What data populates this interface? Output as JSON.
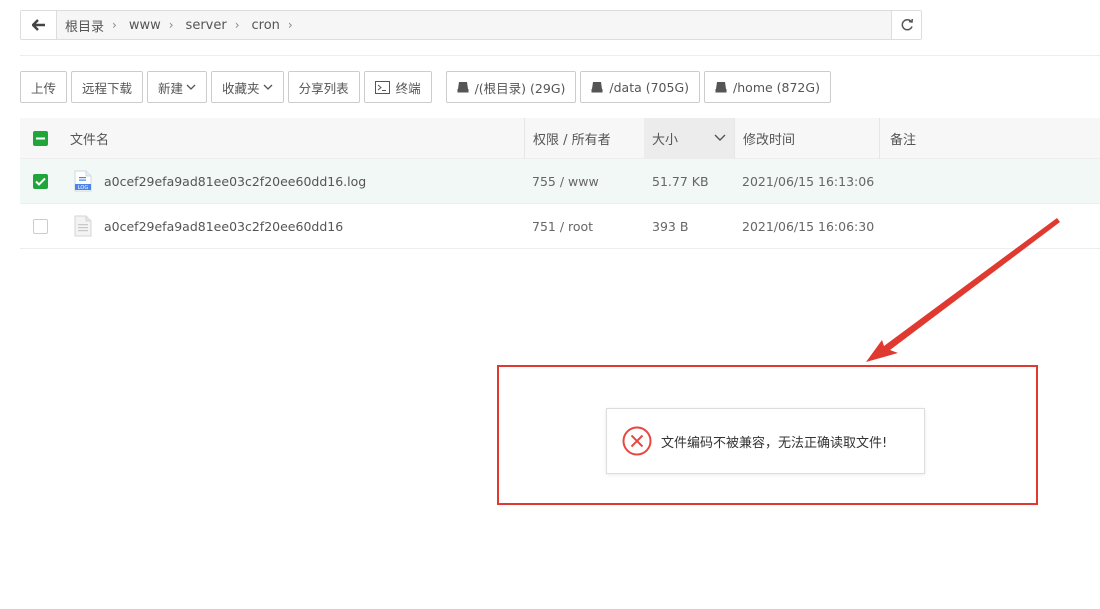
{
  "breadcrumb": {
    "items": [
      "根目录",
      "www",
      "server",
      "cron"
    ]
  },
  "toolbar": {
    "upload": "上传",
    "remote_download": "远程下载",
    "new": "新建",
    "favorites": "收藏夹",
    "share_list": "分享列表",
    "terminal": "终端",
    "disks": [
      {
        "label": "/(根目录) (29G)"
      },
      {
        "label": "/data (705G)"
      },
      {
        "label": "/home (872G)"
      }
    ]
  },
  "table": {
    "headers": {
      "name": "文件名",
      "perm": "权限 / 所有者",
      "size": "大小",
      "time": "修改时间",
      "note": "备注"
    },
    "rows": [
      {
        "name": "a0cef29efa9ad81ee03c2f20ee60dd16.log",
        "perm": "755 / www",
        "size": "51.77 KB",
        "time": "2021/06/15 16:13:06",
        "note": "",
        "selected": true,
        "icon": "log-file-icon"
      },
      {
        "name": "a0cef29efa9ad81ee03c2f20ee60dd16",
        "perm": "751 / root",
        "size": "393 B",
        "time": "2021/06/15 16:06:30",
        "note": "",
        "selected": false,
        "icon": "text-file-icon"
      }
    ]
  },
  "toast": {
    "message": "文件编码不被兼容，无法正确读取文件!"
  },
  "colors": {
    "accent_green": "#20a53a",
    "annotation_red": "#e0392f",
    "error_red": "#e8473f"
  }
}
